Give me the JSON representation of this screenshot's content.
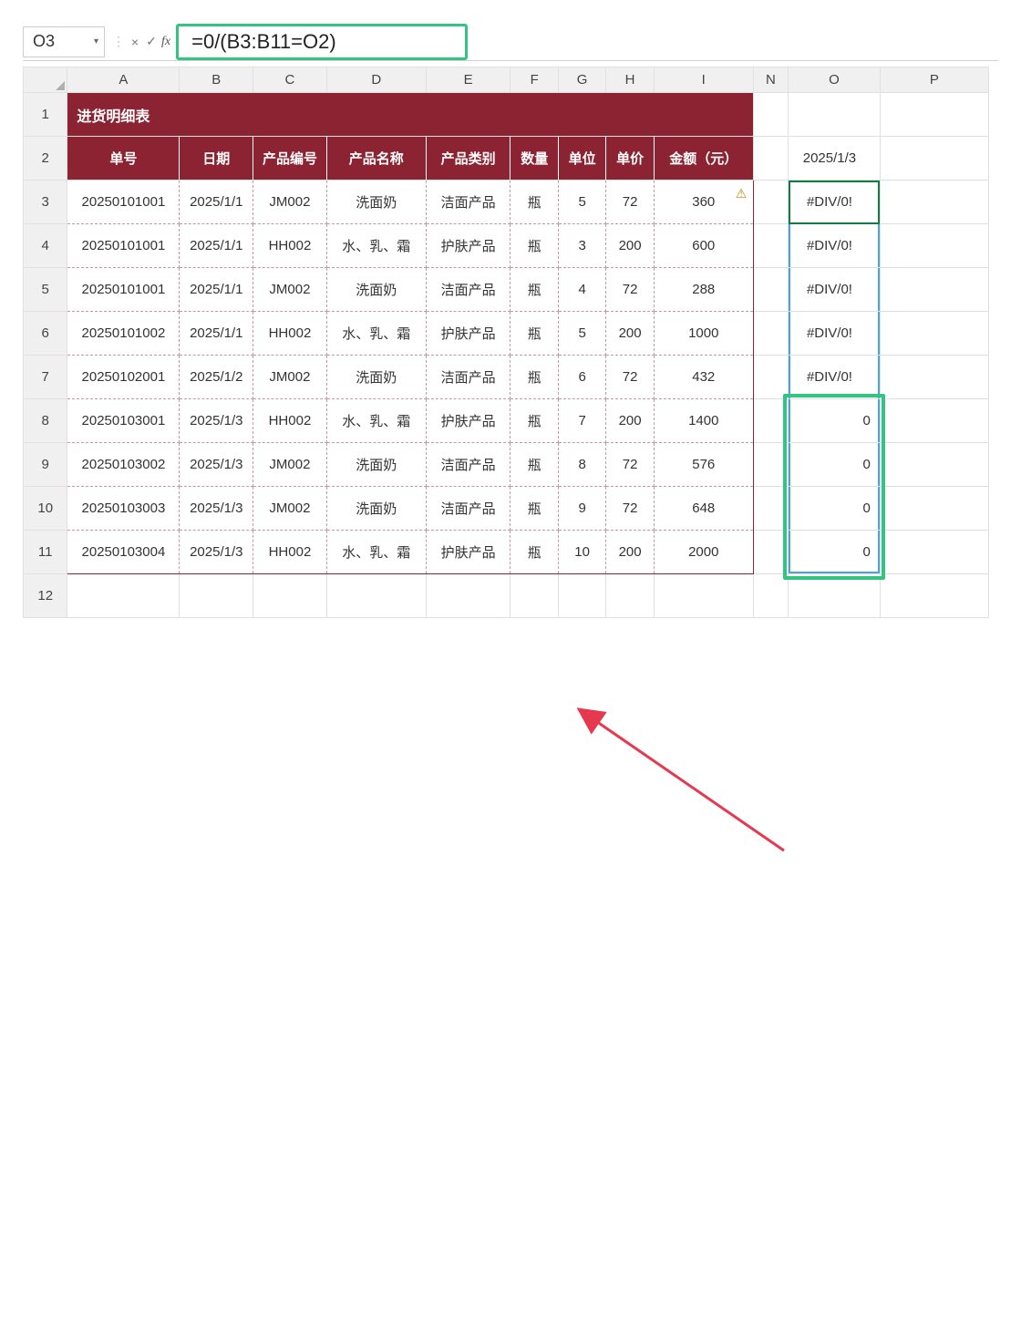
{
  "namebox": {
    "ref": "O3"
  },
  "formula": "=0/(B3:B11=O2)",
  "cols": [
    "A",
    "B",
    "C",
    "D",
    "E",
    "F",
    "G",
    "H",
    "I",
    "N",
    "O",
    "P"
  ],
  "rows": [
    "1",
    "2",
    "3",
    "4",
    "5",
    "6",
    "7",
    "8",
    "9",
    "10",
    "11",
    "12"
  ],
  "table": {
    "title": "进货明细表",
    "headers": [
      "单号",
      "日期",
      "产品编号",
      "产品名称",
      "产品类别",
      "数量",
      "单位",
      "单价",
      "金额（元）"
    ],
    "rows": [
      [
        "20250101001",
        "2025/1/1",
        "JM002",
        "洗面奶",
        "洁面产品",
        "瓶",
        "5",
        "72",
        "360"
      ],
      [
        "20250101001",
        "2025/1/1",
        "HH002",
        "水、乳、霜",
        "护肤产品",
        "瓶",
        "3",
        "200",
        "600"
      ],
      [
        "20250101001",
        "2025/1/1",
        "JM002",
        "洗面奶",
        "洁面产品",
        "瓶",
        "4",
        "72",
        "288"
      ],
      [
        "20250101002",
        "2025/1/1",
        "HH002",
        "水、乳、霜",
        "护肤产品",
        "瓶",
        "5",
        "200",
        "1000"
      ],
      [
        "20250102001",
        "2025/1/2",
        "JM002",
        "洗面奶",
        "洁面产品",
        "瓶",
        "6",
        "72",
        "432"
      ],
      [
        "20250103001",
        "2025/1/3",
        "HH002",
        "水、乳、霜",
        "护肤产品",
        "瓶",
        "7",
        "200",
        "1400"
      ],
      [
        "20250103002",
        "2025/1/3",
        "JM002",
        "洗面奶",
        "洁面产品",
        "瓶",
        "8",
        "72",
        "576"
      ],
      [
        "20250103003",
        "2025/1/3",
        "JM002",
        "洗面奶",
        "洁面产品",
        "瓶",
        "9",
        "72",
        "648"
      ],
      [
        "20250103004",
        "2025/1/3",
        "HH002",
        "水、乳、霜",
        "护肤产品",
        "瓶",
        "10",
        "200",
        "2000"
      ]
    ]
  },
  "colO": {
    "criteria": "2025/1/3",
    "values": [
      "#DIV/0!",
      "#DIV/0!",
      "#DIV/0!",
      "#DIV/0!",
      "#DIV/0!",
      "0",
      "0",
      "0",
      "0"
    ]
  },
  "icons": {
    "cancel": "×",
    "enter": "✓",
    "fx": "fx",
    "warn": "⚠"
  }
}
